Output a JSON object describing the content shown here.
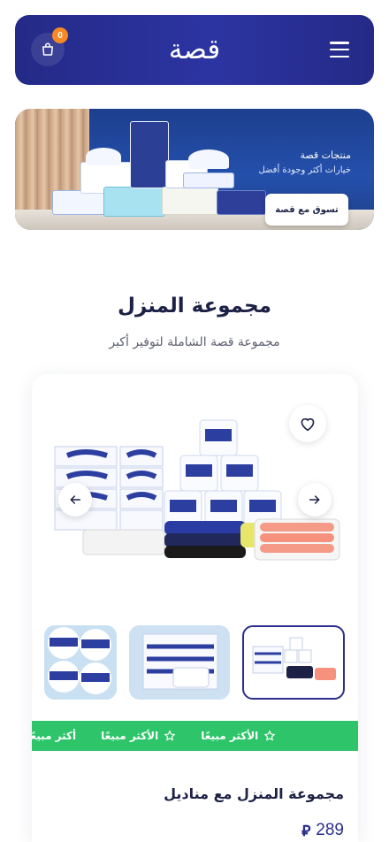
{
  "header": {
    "logo_text": "قصة",
    "cart_count": "0"
  },
  "banner": {
    "title": "منتجات قصة",
    "subtitle": "خيارات أكثر وجودة أفضل",
    "cta_label": "تسوق مع قصة"
  },
  "section": {
    "title": "مجموعة المنزل",
    "subtitle": "مجموعة قصة الشاملة لتوفير أكبر"
  },
  "product": {
    "badges": [
      "أكثر مبيعًا",
      "الأكثر مبيعًا",
      "الأكثر مبيعًا"
    ],
    "name": "مجموعة المنزل مع مناديل",
    "price": "289",
    "currency_symbol": "⃁"
  },
  "colors": {
    "primary": "#2a2f8c",
    "badge": "#f58a24",
    "ribbon": "#2ec46a"
  }
}
